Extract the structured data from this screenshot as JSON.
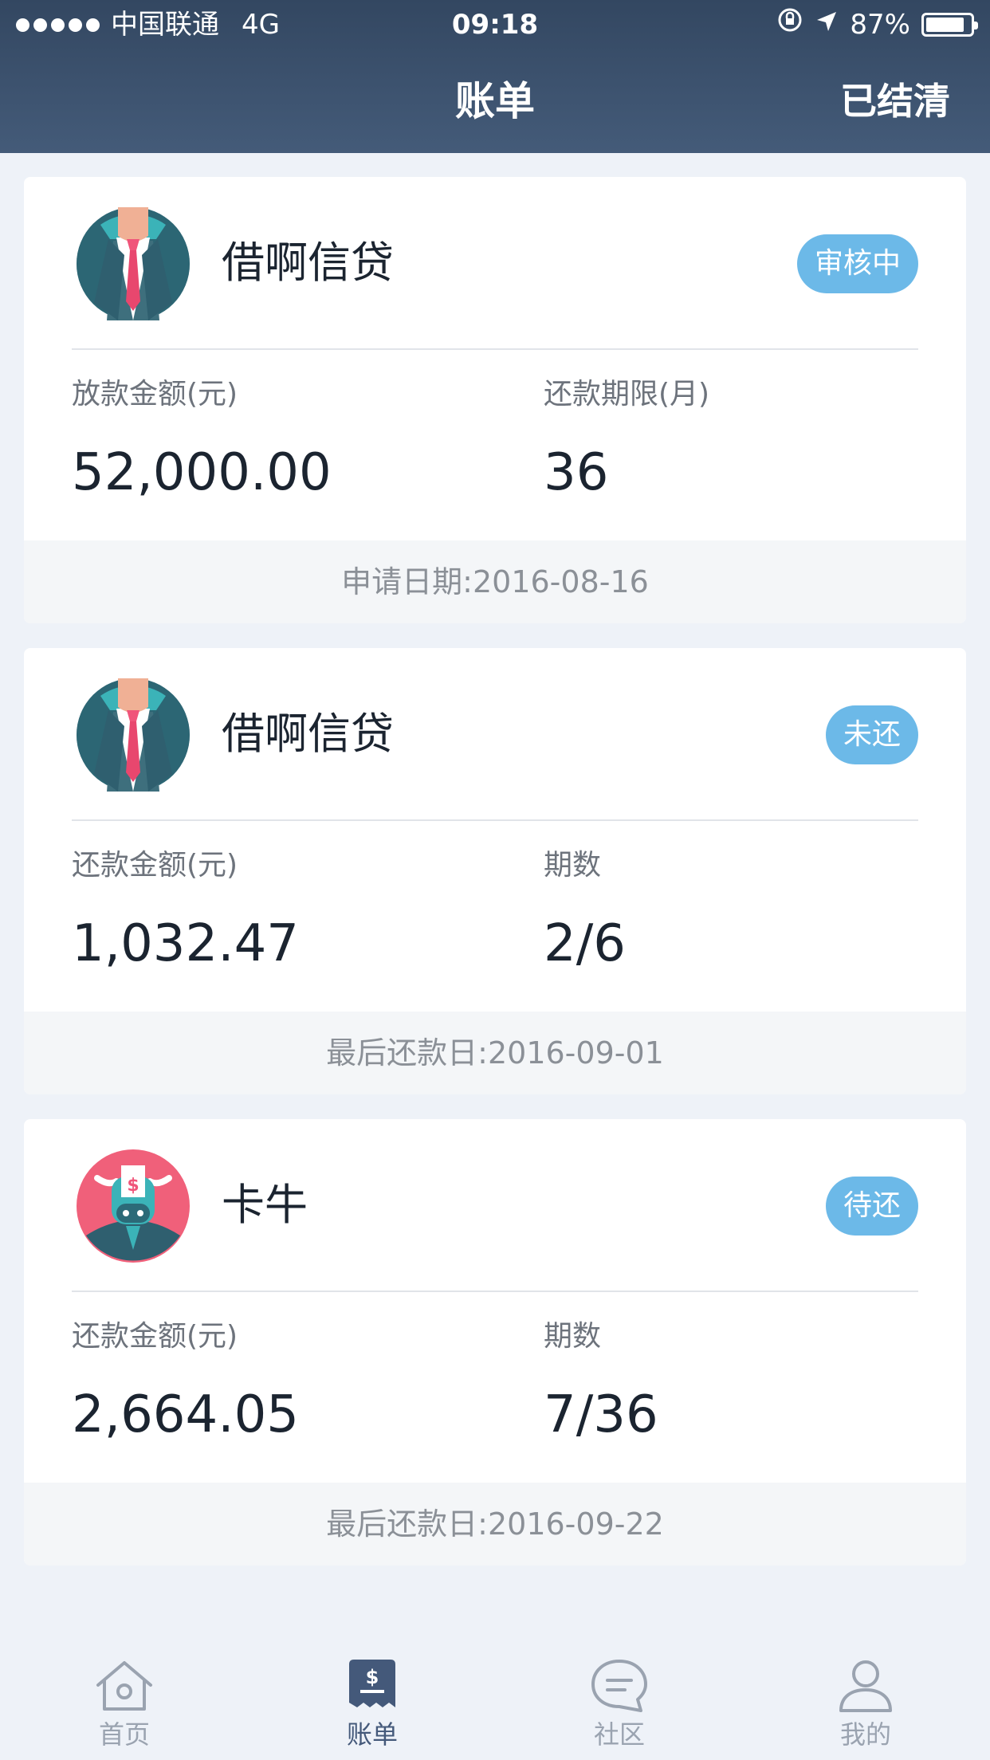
{
  "status_bar": {
    "carrier": "中国联通",
    "network": "4G",
    "time": "09:18",
    "battery": "87%",
    "battery_level": 0.87
  },
  "nav": {
    "title": "账单",
    "right_action": "已结清"
  },
  "cards": [
    {
      "lender": "借啊信贷",
      "avatar_icon": "businessman-avatar-icon",
      "status": "审核中",
      "left_label": "放款金额(元)",
      "left_value": "52,000.00",
      "right_label": "还款期限(月)",
      "right_value": "36",
      "footer": "申请日期:2016-08-16"
    },
    {
      "lender": "借啊信贷",
      "avatar_icon": "businessman-avatar-icon",
      "status": "未还",
      "left_label": "还款金额(元)",
      "left_value": "1,032.47",
      "right_label": "期数",
      "right_value": "2/6",
      "footer": "最后还款日:2016-09-01"
    },
    {
      "lender": "卡牛",
      "avatar_icon": "cow-avatar-icon",
      "status": "待还",
      "left_label": "还款金额(元)",
      "left_value": "2,664.05",
      "right_label": "期数",
      "right_value": "7/36",
      "footer": "最后还款日:2016-09-22"
    }
  ],
  "tabs": [
    {
      "label": "首页",
      "icon": "home-icon",
      "active": false
    },
    {
      "label": "账单",
      "icon": "bill-icon",
      "active": true
    },
    {
      "label": "社区",
      "icon": "chat-icon",
      "active": false
    },
    {
      "label": "我的",
      "icon": "user-icon",
      "active": false
    }
  ],
  "colors": {
    "header": "#3b4f6b",
    "badge": "#6cb9e8",
    "background": "#eef2f8",
    "tab_active": "#44597a",
    "tab_inactive": "#9aa3b0"
  }
}
